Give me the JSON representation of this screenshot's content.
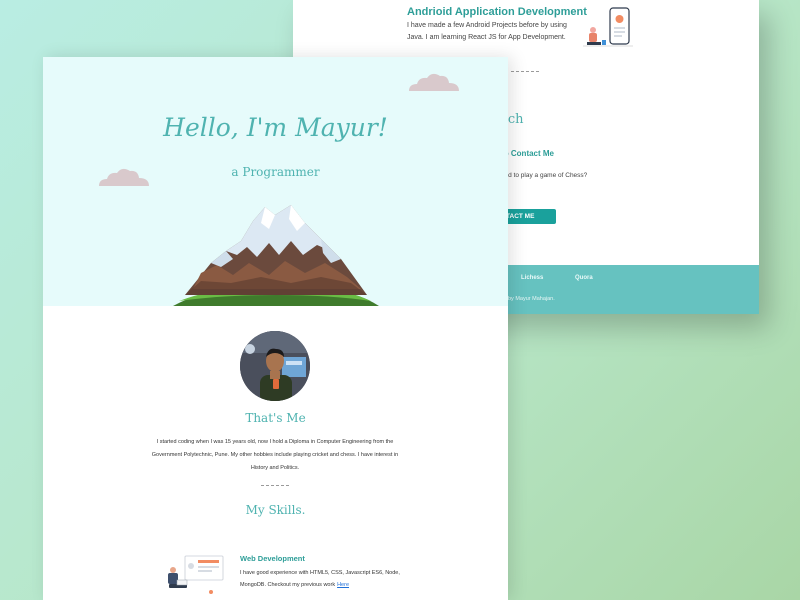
{
  "back_page": {
    "project": {
      "title": "Andrioid Application Development",
      "description": "I have made a few Android Projects before by using Java. I am learning React JS for App Development."
    },
    "contact": {
      "heading": "t In Touch",
      "subheading": "ee to Contact Me",
      "line1": "thing on Quora. Wanted to play a game of Chess?",
      "line2": "nge me on Lichess.",
      "button_label": "CONTACT ME"
    },
    "footer": {
      "links": [
        "Lichess",
        "Quora"
      ],
      "copyright": "by Mayur Mahajan."
    }
  },
  "front_page": {
    "hero": {
      "title": "Hello, I'm Mayur!",
      "subtitle": "a Programmer"
    },
    "about": {
      "heading": "That's Me",
      "text": "I started coding when I was 15 years old, now I hold a Diploma in Computer Engineering from the Government Polytechnic, Pune. My other hobbies include playing cricket and chess. I have interest in History and Politics."
    },
    "skills": {
      "heading": "My Skills.",
      "items": [
        {
          "title": "Web Development",
          "text": "I have good experience with HTML5, CSS, Javascript ES6, Node, MongoDB. Checkout my previous work",
          "link_label": "Here"
        }
      ]
    }
  },
  "colors": {
    "accent": "#4fb3b0",
    "accent_dark": "#2e9e98",
    "hero_bg": "#e6fbfb",
    "footer_bg": "#66c2c0",
    "button_bg": "#1aa19c"
  },
  "icons": [
    "cloud-icon",
    "mountain-illustration",
    "phone-illustration",
    "laptop-illustration"
  ]
}
